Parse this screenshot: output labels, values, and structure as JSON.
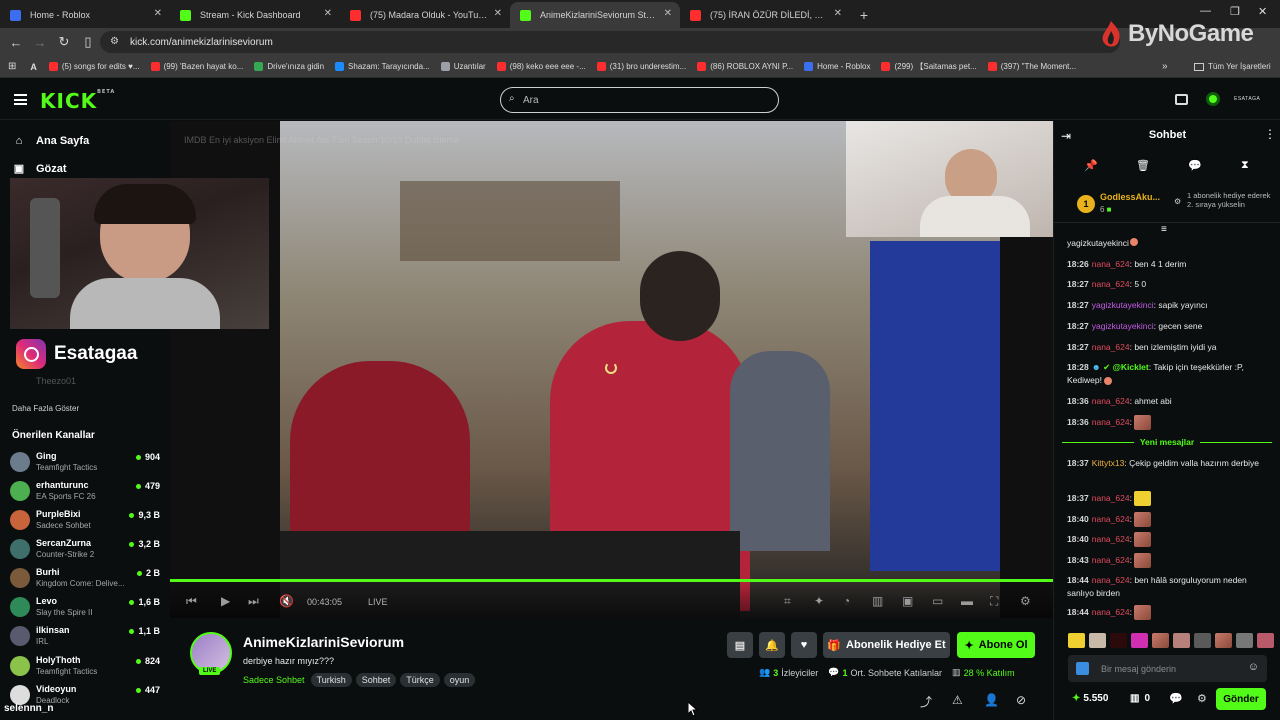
{
  "browser": {
    "tabs": [
      {
        "label": "Home - Roblox",
        "color": "#3b6ff0"
      },
      {
        "label": "Stream - Kick Dashboard",
        "color": "#53fc18"
      },
      {
        "label": "(75) Madara Olduk - YouTube",
        "color": "#ff2d2d"
      },
      {
        "label": "AnimeKizlariniSeviorum Stream",
        "color": "#53fc18"
      },
      {
        "label": "(75) İRAN ÖZÜR DİLEDİ, TESLİM",
        "color": "#ff2d2d"
      }
    ],
    "url": "kick.com/animekizlariniseviorum",
    "bookmarks": [
      {
        "label": "(5) songs for edits ♥...",
        "color": "#ff2d2d"
      },
      {
        "label": "(99) 'Bazen hayat ko...",
        "color": "#ff2d2d"
      },
      {
        "label": "Drive'ınıza gidin",
        "color": "#34a853"
      },
      {
        "label": "Shazam: Tarayıcında...",
        "color": "#1a8cff"
      },
      {
        "label": "Uzantılar",
        "color": "#9aa0a6"
      },
      {
        "label": "(98) keko eee eee -...",
        "color": "#ff2d2d"
      },
      {
        "label": "(31) bro underestim...",
        "color": "#ff2d2d"
      },
      {
        "label": "(86) ROBLOX AYNI P...",
        "color": "#ff2d2d"
      },
      {
        "label": "Home - Roblox",
        "color": "#3b6ff0"
      },
      {
        "label": "(299) 【Saitamas pet...",
        "color": "#ff2d2d"
      },
      {
        "label": "(397) \"The Moment...",
        "color": "#ff2d2d"
      }
    ],
    "all_bookmarks": "Tüm Yer İşaretleri"
  },
  "watermark": "ByNoGame",
  "header": {
    "logo": "KICK",
    "logo_sup": "BETA",
    "search_placeholder": "Ara",
    "user_label": "ESATAGA"
  },
  "sidebar": {
    "nav": [
      "Ana Sayfa",
      "Gözat"
    ],
    "overlay_handle": "Esatagaa",
    "faded_channel": "Theezo01",
    "more": "Daha Fazla Göster",
    "recommended_title": "Önerilen Kanallar",
    "channels": [
      {
        "name": "Ging",
        "game": "Teamfight Tactics",
        "viewers": "904",
        "color": "#6b7c8c"
      },
      {
        "name": "erhanturunc",
        "game": "EA Sports FC 26",
        "viewers": "479",
        "color": "#4caf50"
      },
      {
        "name": "PurpleBixi",
        "game": "Sadece Sohbet",
        "viewers": "9,3 B",
        "color": "#c8643c"
      },
      {
        "name": "SercanZurna",
        "game": "Counter-Strike 2",
        "viewers": "3,2 B",
        "color": "#3f6f6a"
      },
      {
        "name": "Burhi",
        "game": "Kingdom Come: Delive...",
        "viewers": "2 B",
        "color": "#7a5a3a"
      },
      {
        "name": "Levo",
        "game": "Slay the Spire II",
        "viewers": "1,6 B",
        "color": "#2e8b57"
      },
      {
        "name": "ilkinsan",
        "game": "IRL",
        "viewers": "1,1 B",
        "color": "#5a5a6e"
      },
      {
        "name": "HolyThoth",
        "game": "Teamfight Tactics",
        "viewers": "824",
        "color": "#8bc34a"
      },
      {
        "name": "Videoyun",
        "game": "Deadlock",
        "viewers": "447",
        "color": "#ddd"
      }
    ],
    "bottom_name": "selennn_n"
  },
  "video": {
    "overlay_text": "IMDB En iyi aksiyon Eliml Ahmet Abi Tüm Sezon 10/10 Dublaj izleme",
    "time": "00:43:05",
    "live": "LIVE"
  },
  "stream": {
    "name": "AnimeKizlariniSeviorum",
    "title": "derbiye hazır mıyız???",
    "category": "Sadece Sohbet",
    "tags": [
      "Turkish",
      "Sohbet",
      "Türkçe",
      "oyun"
    ],
    "live_badge": "LIVE",
    "gift_button": "Abonelik Hediye Et",
    "subscribe_button": "Abone Ol",
    "viewers_count": "3",
    "viewers_label": "İzleyiciler",
    "chatters_count": "1",
    "chatters_label": "Ort. Sohbete Katılanlar",
    "participation": "28 % Katılım"
  },
  "chat": {
    "title": "Sohbet",
    "pinned": {
      "user": "GodlessAku...",
      "sub": "6",
      "text": "1 abonelik hediye ederek 2. sıraya yükselin"
    },
    "messages": [
      {
        "time": "",
        "user": "yagizkutayekinci",
        "ucls": "plain",
        "text": ""
      },
      {
        "time": "18:26",
        "user": "nana_624",
        "ucls": "u-nana",
        "text": "ben 4 1 derim"
      },
      {
        "time": "18:27",
        "user": "nana_624",
        "ucls": "u-nana",
        "text": "5 0"
      },
      {
        "time": "18:27",
        "user": "yagizkutayekinci",
        "ucls": "u-yag",
        "text": "sapik yayıncı"
      },
      {
        "time": "18:27",
        "user": "yagizkutayekinci",
        "ucls": "u-yag",
        "text": "gecen sene"
      },
      {
        "time": "18:27",
        "user": "nana_624",
        "ucls": "u-nana",
        "text": "ben izlemiştim iyidi ya"
      },
      {
        "time": "18:28",
        "user": "@Kicklet",
        "ucls": "u-kick",
        "text": "Takip için teşekkürler :P, Kediwep!"
      },
      {
        "time": "18:36",
        "user": "nana_624",
        "ucls": "u-nana",
        "text": "ahmet abi"
      },
      {
        "time": "18:36",
        "user": "nana_624",
        "ucls": "u-nana",
        "text": ""
      },
      {
        "time": "18:37",
        "user": "Kittytx13",
        "ucls": "u-kitty",
        "text": "Çekip geldim valla hazırım derbiye"
      },
      {
        "time": "18:37",
        "user": "nana_624",
        "ucls": "u-nana",
        "text": ""
      },
      {
        "time": "18:40",
        "user": "nana_624",
        "ucls": "u-nana",
        "text": ""
      },
      {
        "time": "18:40",
        "user": "nana_624",
        "ucls": "u-nana",
        "text": ""
      },
      {
        "time": "18:43",
        "user": "nana_624",
        "ucls": "u-nana",
        "text": ""
      },
      {
        "time": "18:44",
        "user": "nana_624",
        "ucls": "u-nana",
        "text": "ben hâlâ sorguluyorum neden sanlıyo birden"
      },
      {
        "time": "18:44",
        "user": "nana_624",
        "ucls": "u-nana",
        "text": ""
      }
    ],
    "new_messages": "Yeni mesajlar",
    "input_placeholder": "Bir mesaj gönderin",
    "points": "5.550",
    "gift_count": "0",
    "send_button": "Gönder"
  }
}
